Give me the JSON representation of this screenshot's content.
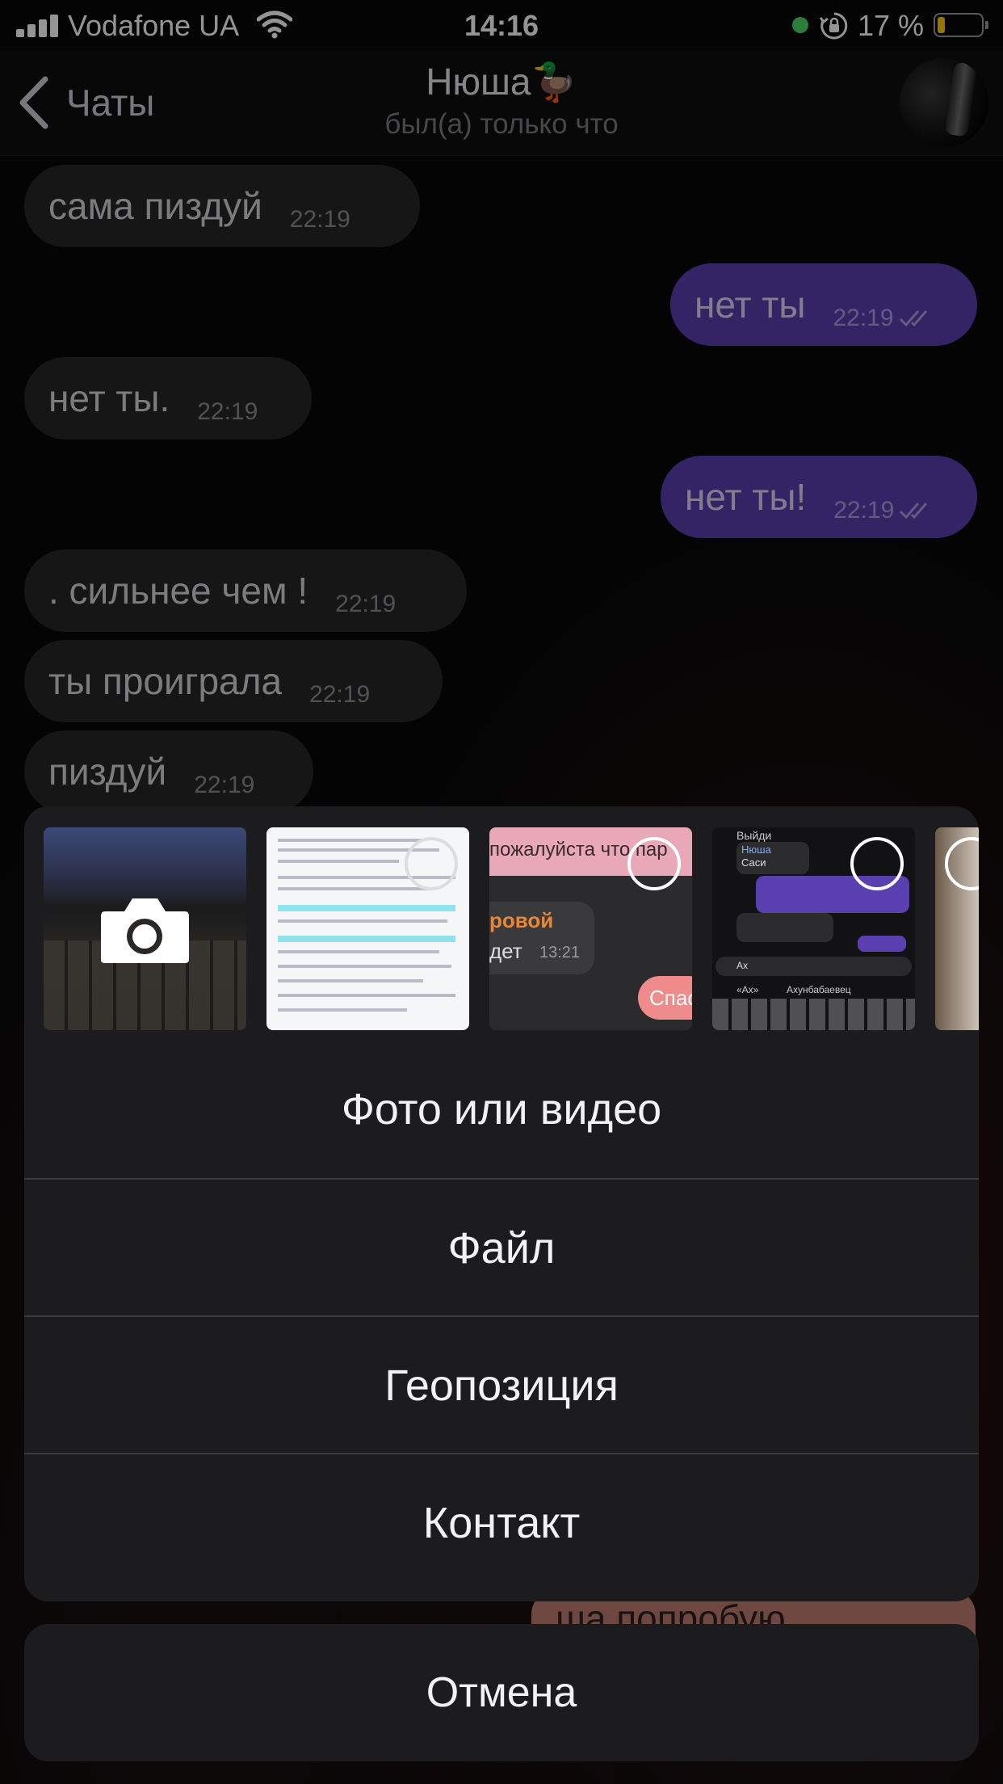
{
  "status_bar": {
    "carrier": "Vodafone UA",
    "time": "14:16",
    "battery_percent": "17 %",
    "battery_level": 0.17,
    "icons": [
      "signal-icon",
      "wifi-icon",
      "green-dot",
      "orientation-lock-icon",
      "battery-icon"
    ]
  },
  "nav": {
    "back_label": "Чаты",
    "contact_name": "Нюша🦆",
    "contact_status": "был(а) только что"
  },
  "messages": [
    {
      "direction": "in",
      "text": "сама пиздуй",
      "time": "22:19"
    },
    {
      "direction": "out",
      "text": "нет ты",
      "time": "22:19"
    },
    {
      "direction": "in",
      "text": "нет ты.",
      "time": "22:19"
    },
    {
      "direction": "out",
      "text": "нет ты!",
      "time": "22:19"
    },
    {
      "direction": "in",
      "text": ". сильнее чем !",
      "time": "22:19"
    },
    {
      "direction": "in",
      "text": "ты проиграла",
      "time": "22:19"
    },
    {
      "direction": "in",
      "text": "пиздуй",
      "time": "22:19"
    }
  ],
  "peek_message": "ша попробую",
  "sheet": {
    "thumb_chat1": {
      "line1": "пожалуйста что пар",
      "line2": "ровой",
      "line3": "дет",
      "time": "13:21",
      "button": "Спас"
    },
    "thumb_chat2": {
      "top": "Выйди",
      "name": "Нюша",
      "sub": "Саси",
      "input": "Ах",
      "suggest1": "«Ах»",
      "suggest2": "Ахунбабаевец"
    },
    "items": [
      "Фото или видео",
      "Файл",
      "Геопозиция",
      "Контакт"
    ],
    "cancel": "Отмена"
  },
  "colors": {
    "incoming_bubble": "#262628",
    "outgoing_bubble": "#5a3fb0",
    "sheet_bg": "#1c1c1e"
  }
}
